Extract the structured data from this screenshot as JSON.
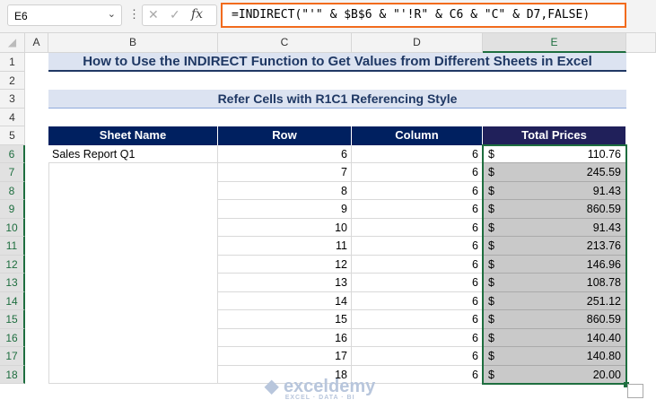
{
  "formula_bar": {
    "name_box": "E6",
    "formula": "=INDIRECT(\"'\" & $B$6 & \"'!R\" & C6 & \"C\" & D7,FALSE)",
    "fx_label": "fx"
  },
  "columns": [
    "A",
    "B",
    "C",
    "D",
    "E"
  ],
  "rows": [
    "1",
    "2",
    "3",
    "4",
    "5",
    "6",
    "7",
    "8",
    "9",
    "10",
    "11",
    "12",
    "13",
    "14",
    "15",
    "16",
    "17",
    "18"
  ],
  "title": "How to Use the INDIRECT Function to Get Values from Different Sheets in Excel",
  "subtitle": "Refer Cells with R1C1 Referencing Style",
  "table": {
    "headers": [
      "Sheet Name",
      "Row",
      "Column",
      "Total Prices"
    ],
    "rows": [
      {
        "sheet": "Sales Report Q1",
        "row": "6",
        "col": "6",
        "cur": "$",
        "price": "110.76"
      },
      {
        "sheet": "",
        "row": "7",
        "col": "6",
        "cur": "$",
        "price": "245.59"
      },
      {
        "sheet": "",
        "row": "8",
        "col": "6",
        "cur": "$",
        "price": "91.43"
      },
      {
        "sheet": "",
        "row": "9",
        "col": "6",
        "cur": "$",
        "price": "860.59"
      },
      {
        "sheet": "",
        "row": "10",
        "col": "6",
        "cur": "$",
        "price": "91.43"
      },
      {
        "sheet": "",
        "row": "11",
        "col": "6",
        "cur": "$",
        "price": "213.76"
      },
      {
        "sheet": "",
        "row": "12",
        "col": "6",
        "cur": "$",
        "price": "146.96"
      },
      {
        "sheet": "",
        "row": "13",
        "col": "6",
        "cur": "$",
        "price": "108.78"
      },
      {
        "sheet": "",
        "row": "14",
        "col": "6",
        "cur": "$",
        "price": "251.12"
      },
      {
        "sheet": "",
        "row": "15",
        "col": "6",
        "cur": "$",
        "price": "860.59"
      },
      {
        "sheet": "",
        "row": "16",
        "col": "6",
        "cur": "$",
        "price": "140.40"
      },
      {
        "sheet": "",
        "row": "17",
        "col": "6",
        "cur": "$",
        "price": "140.80"
      },
      {
        "sheet": "",
        "row": "18",
        "col": "6",
        "cur": "$",
        "price": "20.00"
      }
    ]
  },
  "watermark": {
    "name": "exceldemy",
    "tagline": "EXCEL · DATA · BI"
  }
}
